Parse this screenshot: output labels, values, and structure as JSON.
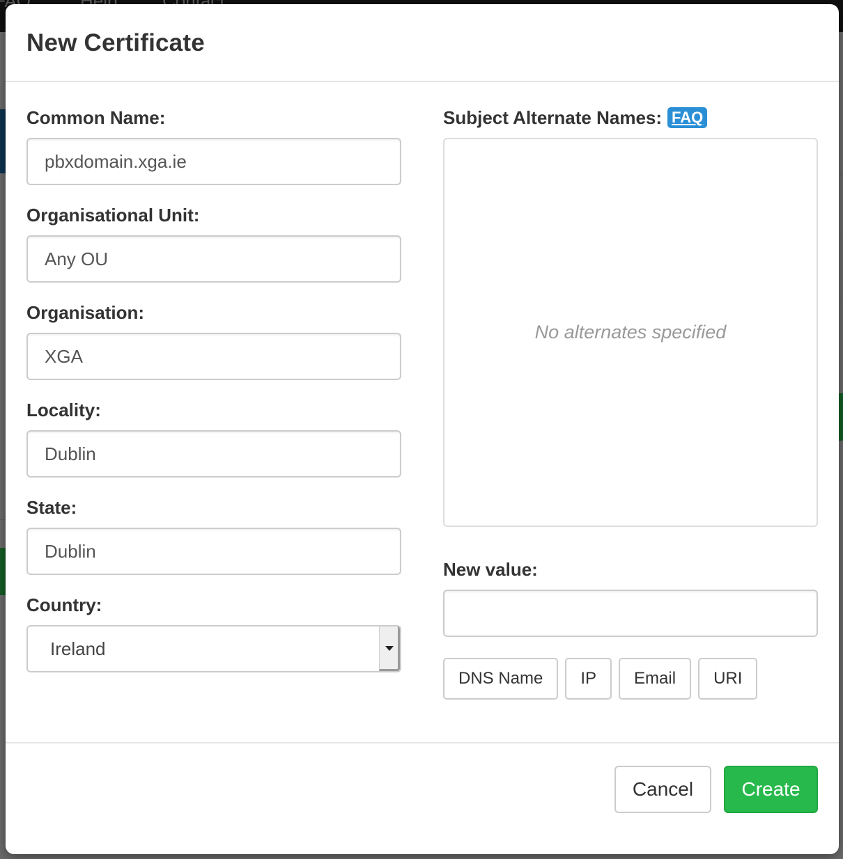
{
  "background": {
    "navbar_links": [
      "FAQ",
      "Help",
      "Contact"
    ]
  },
  "modal": {
    "title": "New Certificate",
    "fields": {
      "common_name": {
        "label": "Common Name:",
        "value": "pbxdomain.xga.ie"
      },
      "org_unit": {
        "label": "Organisational Unit:",
        "value": "Any OU"
      },
      "organisation": {
        "label": "Organisation:",
        "value": "XGA"
      },
      "locality": {
        "label": "Locality:",
        "value": "Dublin"
      },
      "state": {
        "label": "State:",
        "value": "Dublin"
      },
      "country": {
        "label": "Country:",
        "selected": "Ireland"
      }
    },
    "san": {
      "label": "Subject Alternate Names:",
      "faq_link": "FAQ",
      "empty_text": "No alternates specified",
      "new_value_label": "New value:",
      "new_value": "",
      "type_buttons": [
        "DNS Name",
        "IP",
        "Email",
        "URI"
      ]
    },
    "footer": {
      "cancel_label": "Cancel",
      "create_label": "Create"
    }
  },
  "colors": {
    "accent_blue": "#2b8fd6",
    "create_green": "#28b94d"
  }
}
